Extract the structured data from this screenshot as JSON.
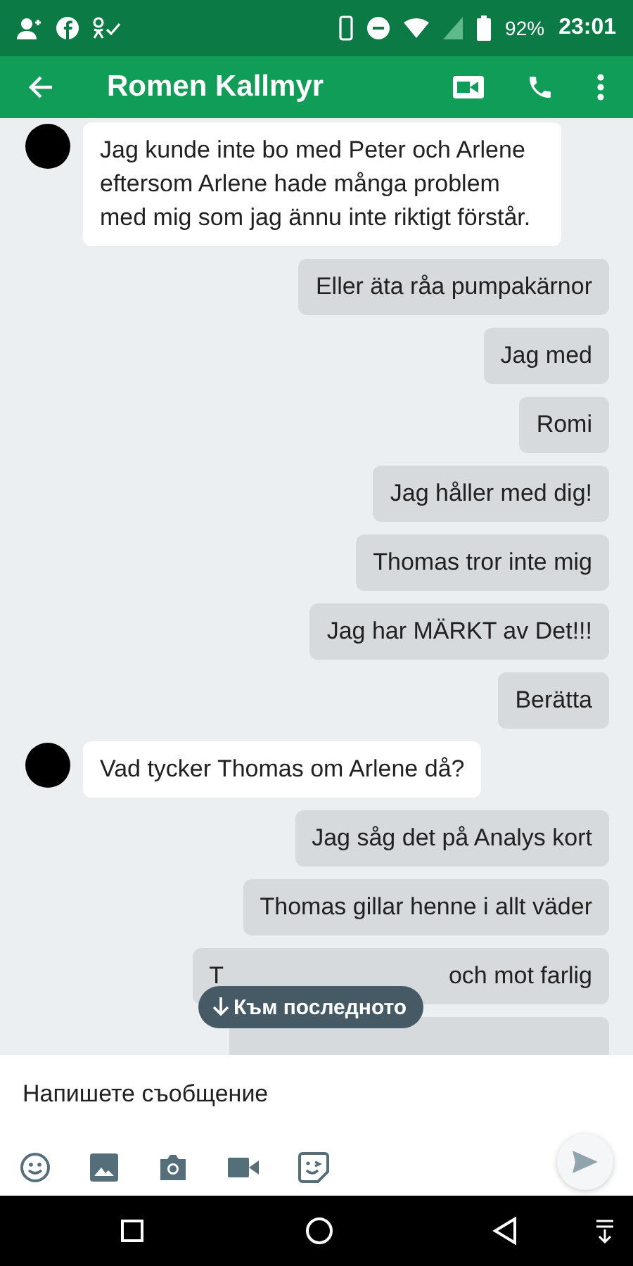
{
  "status_bar": {
    "battery": "92%",
    "time": "23:01"
  },
  "header": {
    "title": "Romen Kallmyr"
  },
  "messages": [
    {
      "kind": "incoming",
      "text": "Jag kunde inte bo med Peter och Arlene eftersom Arlene hade många problem med mig som jag ännu inte riktigt förstår."
    },
    {
      "kind": "outgoing",
      "text": "Eller äta råa pumpakärnor"
    },
    {
      "kind": "outgoing",
      "text": "Jag med"
    },
    {
      "kind": "outgoing",
      "text": "Romi"
    },
    {
      "kind": "outgoing",
      "text": "Jag håller med dig!"
    },
    {
      "kind": "outgoing",
      "text": "Thomas tror inte mig"
    },
    {
      "kind": "outgoing",
      "text": "Jag har MÄRKT av Det!!!"
    },
    {
      "kind": "outgoing",
      "text": "Berätta"
    },
    {
      "kind": "incoming",
      "text": "Vad tycker Thomas om Arlene då?"
    },
    {
      "kind": "outgoing",
      "text": "Jag såg det på Analys kort"
    },
    {
      "kind": "outgoing",
      "text": "Thomas gillar henne i allt väder"
    },
    {
      "kind": "covered",
      "text_start": "T",
      "text_end": "och mot farlig"
    }
  ],
  "jump_button": {
    "label": "Към последното"
  },
  "compose": {
    "placeholder": "Напишете съобщение"
  }
}
